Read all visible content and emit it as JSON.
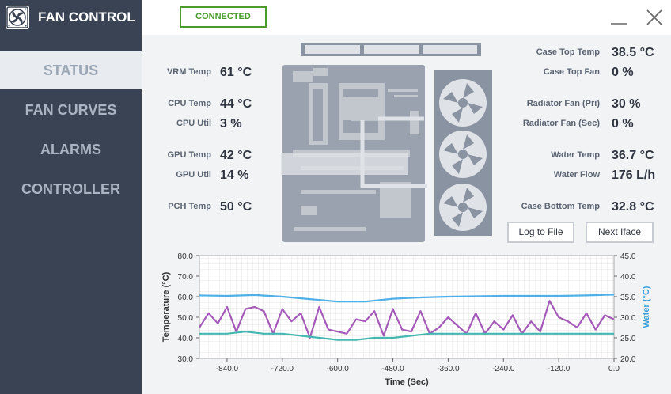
{
  "app": {
    "title": "FAN CONTROL",
    "status": "CONNECTED"
  },
  "nav": {
    "items": [
      {
        "label": "STATUS",
        "active": true
      },
      {
        "label": "FAN CURVES"
      },
      {
        "label": "ALARMS"
      },
      {
        "label": "CONTROLLER"
      }
    ]
  },
  "left_readouts": [
    {
      "label": "VRM Temp",
      "value": "61 °C"
    },
    {
      "label": "CPU Temp",
      "value": "44 °C"
    },
    {
      "label": "CPU Util",
      "value": "3 %"
    },
    {
      "label": "GPU Temp",
      "value": "42 °C"
    },
    {
      "label": "GPU Util",
      "value": "14 %"
    },
    {
      "label": "PCH Temp",
      "value": "50 °C"
    }
  ],
  "right_readouts": [
    {
      "label": "Case Top Temp",
      "value": "38.5 °C"
    },
    {
      "label": "Case Top Fan",
      "value": "0 %"
    },
    {
      "label": "Radiator Fan (Pri)",
      "value": "30 %"
    },
    {
      "label": "Radiator Fan (Sec)",
      "value": "0 %"
    },
    {
      "label": "Water Temp",
      "value": "36.7 °C"
    },
    {
      "label": "Water Flow",
      "value": "176 L/h"
    },
    {
      "label": "Case Bottom Temp",
      "value": "32.8 °C"
    }
  ],
  "buttons": {
    "log": "Log to File",
    "next": "Next Iface"
  },
  "chart_data": {
    "type": "line",
    "xlabel": "Time (Sec)",
    "ylabel": "Temperature (°C)",
    "y2label": "Water (°C)",
    "xlim": [
      -900,
      0
    ],
    "ylim": [
      30,
      80
    ],
    "y2lim": [
      20,
      45
    ],
    "xticks": [
      -840,
      -720,
      -600,
      -480,
      -360,
      -240,
      -120,
      0
    ],
    "xtick_labels": [
      "-840.0",
      "-720.0",
      "-600.0",
      "-480.0",
      "-360.0",
      "-240.0",
      "-120.0",
      "0.0"
    ],
    "yticks": [
      80,
      70,
      60,
      50,
      40,
      30
    ],
    "ytick_labels": [
      "80.0",
      "70.0",
      "60.0",
      "50.0",
      "40.0",
      "30.0"
    ],
    "y2ticks": [
      45,
      40,
      35,
      30,
      25,
      20
    ],
    "y2tick_labels": [
      "45.0",
      "40.0",
      "35.0",
      "30.0",
      "25.0",
      "20.0"
    ],
    "colors": {
      "water": "#4fb0e8",
      "cpu": "#a55aba",
      "gpu": "#44b8b0",
      "left_axis": "#333333",
      "right_axis": "#3aa0d8"
    },
    "series": [
      {
        "key": "water",
        "axis": "right",
        "x": [
          -900,
          -840,
          -780,
          -720,
          -660,
          -600,
          -540,
          -480,
          -420,
          -360,
          -300,
          -240,
          -180,
          -120,
          -60,
          0
        ],
        "values": [
          35.3,
          35.2,
          35.4,
          35.0,
          34.4,
          33.8,
          33.8,
          34.5,
          34.8,
          35.0,
          35.1,
          35.2,
          35.2,
          35.2,
          35.3,
          35.5
        ]
      },
      {
        "key": "cpu",
        "axis": "left",
        "x": [
          -900,
          -880,
          -860,
          -840,
          -820,
          -800,
          -780,
          -760,
          -740,
          -720,
          -700,
          -680,
          -660,
          -640,
          -620,
          -600,
          -580,
          -560,
          -540,
          -520,
          -500,
          -480,
          -460,
          -440,
          -420,
          -400,
          -380,
          -360,
          -340,
          -320,
          -300,
          -280,
          -260,
          -240,
          -220,
          -200,
          -180,
          -160,
          -140,
          -120,
          -100,
          -80,
          -60,
          -40,
          -20,
          0
        ],
        "values": [
          45,
          52,
          47,
          55,
          43,
          54,
          55,
          53,
          42,
          54,
          48,
          52,
          40,
          55,
          44,
          43,
          42,
          49,
          48,
          53,
          41,
          54,
          44,
          43,
          53,
          42,
          45,
          50,
          46,
          42,
          52,
          42,
          48,
          44,
          51,
          42,
          48,
          43,
          58,
          50,
          48,
          45,
          52,
          44,
          51,
          49
        ]
      },
      {
        "key": "gpu",
        "axis": "left",
        "x": [
          -900,
          -840,
          -800,
          -760,
          -720,
          -680,
          -640,
          -600,
          -560,
          -520,
          -480,
          -440,
          -400,
          -360,
          -320,
          -280,
          -240,
          -200,
          -160,
          -120,
          -80,
          -40,
          0
        ],
        "values": [
          42,
          42,
          43,
          42,
          42,
          41,
          40,
          39,
          39,
          40,
          40,
          41,
          42,
          42,
          42,
          42,
          42,
          42,
          42,
          42,
          42,
          42,
          42
        ]
      }
    ]
  }
}
